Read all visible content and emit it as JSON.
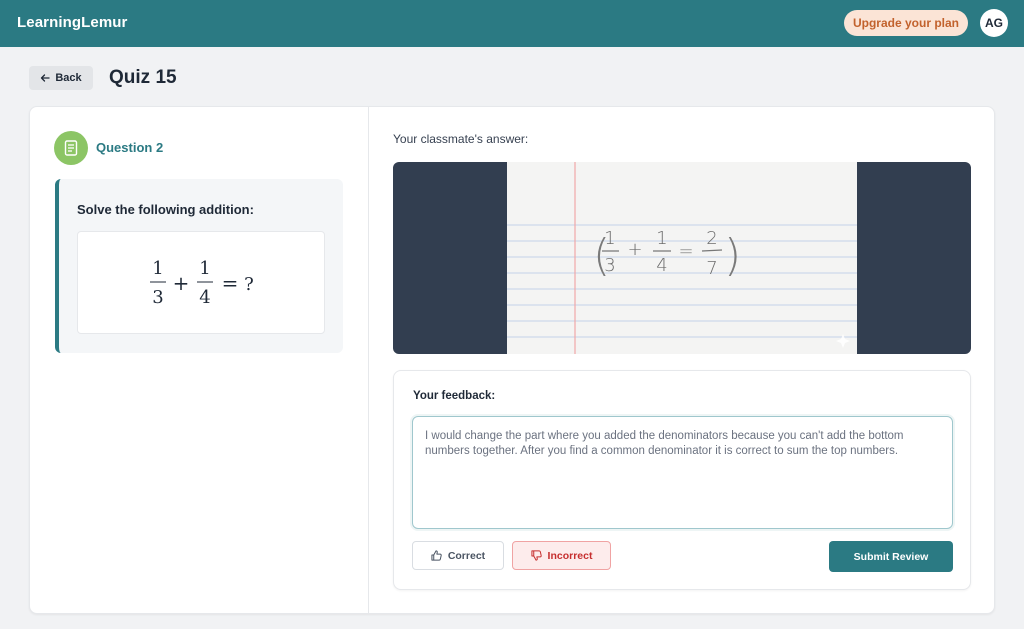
{
  "header": {
    "brand": "LearningLemur",
    "upgrade_label": "Upgrade your plan",
    "avatar_initials": "AG",
    "bar_color": "#2b7a83"
  },
  "page": {
    "back_label": "Back",
    "title": "Quiz 15"
  },
  "question": {
    "label": "Question 2",
    "prompt": "Solve the following addition:",
    "equation": {
      "term1_num": "1",
      "term1_den": "3",
      "operator": "+",
      "term2_num": "1",
      "term2_den": "4",
      "equals": "=",
      "result": "?"
    },
    "icon": "document-icon"
  },
  "answer": {
    "label": "Your classmate's answer:",
    "handwritten": {
      "term1_num": "1",
      "term1_den": "3",
      "operator": "+",
      "term2_num": "1",
      "term2_den": "4",
      "equals": "=",
      "result_num": "2",
      "result_den": "7"
    }
  },
  "feedback": {
    "label": "Your feedback:",
    "text": "I would change the part where you added the denominators because you can't add the bottom numbers together. After you find a common denominator it is correct to sum the top numbers.",
    "correct_label": "Correct",
    "incorrect_label": "Incorrect",
    "submit_label": "Submit Review",
    "accent_color": "#2b7a83",
    "incorrect_color": "#c62f2f"
  }
}
